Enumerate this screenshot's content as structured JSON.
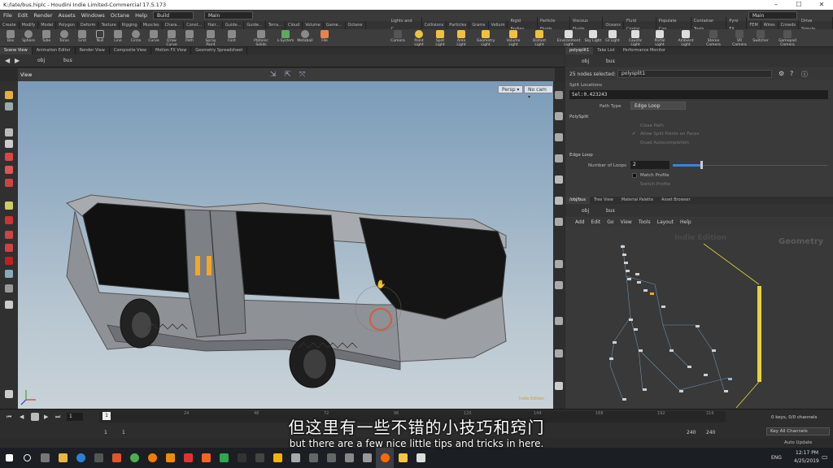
{
  "window": {
    "title": "K:/late/bus.hiplc - Houdini Indie Limited-Commercial 17.5.173",
    "controls": [
      "–",
      "☐",
      "✕"
    ]
  },
  "menubar": {
    "items": [
      "File",
      "Edit",
      "Render",
      "Assets",
      "Windows",
      "Octane",
      "Help"
    ],
    "desktop_left": "Build",
    "desktop_center": "Main",
    "desktop_right": "Main"
  },
  "shelf": {
    "tabs_left": [
      "Create",
      "Modify",
      "Model",
      "Polygon",
      "Deform",
      "Texture",
      "Rigging",
      "Muscles",
      "Chara...",
      "Const...",
      "Hair...",
      "Guide...",
      "Guide...",
      "Terra...",
      "Cloud",
      "Volume",
      "Game...",
      "Octane"
    ],
    "tabs_right": [
      "Lights and C...",
      "Collisions",
      "Particles",
      "Grains",
      "Vellum",
      "Rigid Bodies",
      "Particle Fluids",
      "Viscous Fluids",
      "Oceans",
      "Fluid Contai...",
      "Populate Con...",
      "Container Tools",
      "Pyro FX",
      "FEM",
      "Wires",
      "Crowds",
      "Drive Simula..."
    ],
    "tools_left": [
      "Box",
      "Sphere",
      "Tube",
      "Torus",
      "Grid",
      "Null",
      "Line",
      "Circle",
      "Curve",
      "Draw Curve",
      "Path",
      "Spray Paint",
      "Font",
      "Platonic Solids",
      "L-System",
      "Metaball",
      "File"
    ],
    "tools_right": [
      "Camera",
      "Point Light",
      "Spot Light",
      "Area Light",
      "Geometry Light",
      "Volume Light",
      "Distant Light",
      "Environment Light",
      "Sky Light",
      "GI Light",
      "Caustic Light",
      "Portal Light",
      "Ambient Light",
      "Stereo Camera",
      "VR Camera",
      "Switcher",
      "Gamepad Camera"
    ]
  },
  "panes_left": [
    "Scene View",
    "Animation Editor",
    "Render View",
    "Composite View",
    "Motion FX View",
    "Geometry Spreadsheet"
  ],
  "path": {
    "root": "obj",
    "node": "bus"
  },
  "viewport": {
    "label": "View",
    "persp": "Persp ▾",
    "cam": "No cam ▾",
    "watermark": "Indie Edition"
  },
  "params": {
    "tabs": [
      "polysplit1",
      "Take List",
      "Performance Monitor"
    ],
    "path_root": "obj",
    "path_node": "bus",
    "selected": "25 nodes selected:",
    "node_name": "polysplit1",
    "split_locations": "Split Locations",
    "sel_value": "Sel:0.423243",
    "path_type_label": "Path Type",
    "path_type": "Edge Loop",
    "polysplit_header": "PolySplit",
    "close_path": "Close Path",
    "allow_split": "Allow Split Points on Faces",
    "quad_auto": "Quad Autocompletion",
    "edge_loop_header": "Edge Loop",
    "loops_label": "Number of Loops",
    "loops_value": "2",
    "match_profile": "Match Profile",
    "switch_profile": "Switch Profile"
  },
  "network": {
    "tabs": [
      "/obj/bus",
      "Tree View",
      "Material Palette",
      "Asset Browser"
    ],
    "path_root": "obj",
    "path_node": "bus",
    "menu": [
      "Add",
      "Edit",
      "Go",
      "View",
      "Tools",
      "Layout",
      "Help"
    ],
    "watermark": "Indie Edition",
    "context": "Geometry"
  },
  "timeline": {
    "frame": "1",
    "start": "1",
    "start2": "1",
    "end": "240",
    "end2": "240",
    "ticks": [
      "24",
      "48",
      "72",
      "96",
      "120",
      "144",
      "168",
      "192",
      "216"
    ],
    "keys": "0 keys, 0/0 channels",
    "key_all": "Key All Channels",
    "auto_update": "Auto Update"
  },
  "subtitles": {
    "zh": "但这里有一些不错的小技巧和窍门",
    "en": "but there are a few nice little tips and tricks in here."
  },
  "taskbar": {
    "time": "12:17 PM",
    "date": "4/25/2019",
    "lang": "ENG"
  },
  "colors": {
    "accent": "#f5a623",
    "selection_yellow": "#e6d33a"
  }
}
